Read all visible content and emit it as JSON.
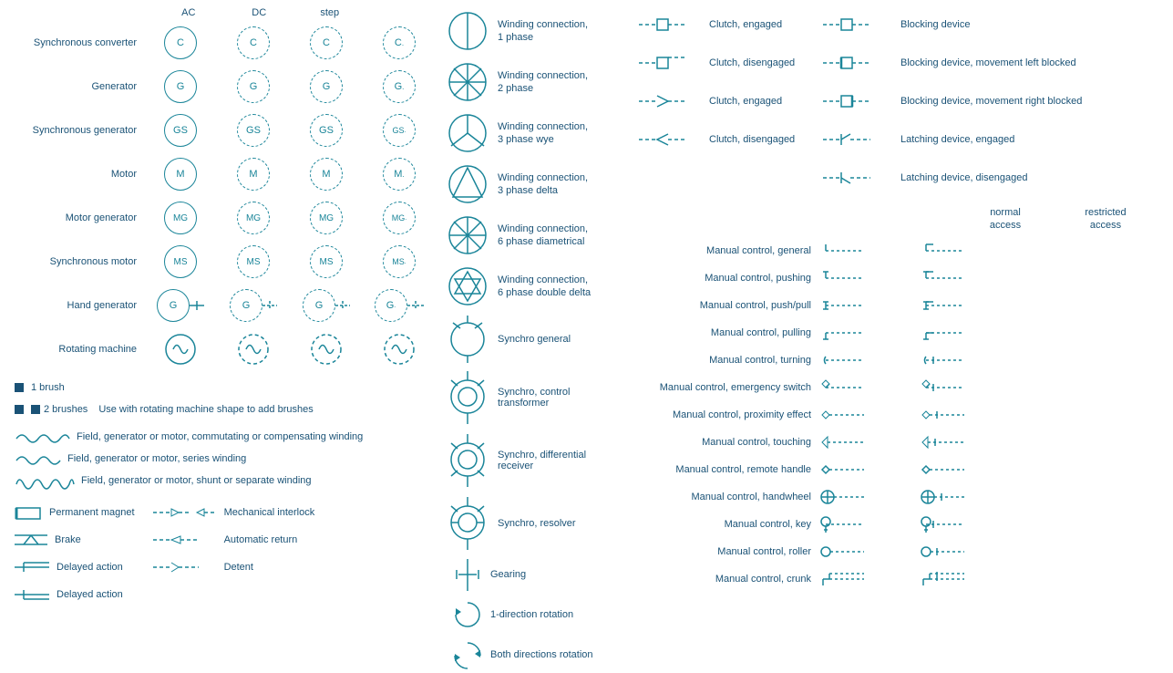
{
  "columns": {
    "labels": [
      "AC",
      "DC",
      "step"
    ]
  },
  "machines": [
    {
      "label": "Synchronous converter",
      "symbol": "C"
    },
    {
      "label": "Generator",
      "symbol": "G"
    },
    {
      "label": "Synchronous generator",
      "symbol": "GS"
    },
    {
      "label": "Motor",
      "symbol": "M"
    },
    {
      "label": "Motor generator",
      "symbol": "MG"
    },
    {
      "label": "Synchronous motor",
      "symbol": "MS"
    },
    {
      "label": "Hand generator",
      "symbol": "G",
      "has_lines": true
    },
    {
      "label": "Rotating machine",
      "symbol": "",
      "is_arc": true
    }
  ],
  "brushes": [
    {
      "label": "1 brush"
    },
    {
      "label": "2 brushes",
      "extra": "Use with rotating machine shape to add brushes"
    }
  ],
  "windings": [
    {
      "label": "Field, generator or motor, commutating or compensating winding"
    },
    {
      "label": "Field, generator or motor, series winding"
    },
    {
      "label": "Field, generator or motor, shunt or separate winding"
    }
  ],
  "misc_left": [
    {
      "symbol": "bracket",
      "label": "Permanent magnet"
    },
    {
      "symbol": "brake",
      "label": "Brake"
    },
    {
      "symbol": "delayed",
      "label": "Delayed action"
    },
    {
      "symbol": "delayed2",
      "label": "Delayed action"
    }
  ],
  "misc_right": [
    {
      "symbol": "mech_interlock",
      "label": "Mechanical interlock"
    },
    {
      "symbol": "auto_return",
      "label": "Automatic return"
    },
    {
      "symbol": "detent",
      "label": "Detent"
    }
  ],
  "winding_connections": [
    {
      "label": "Winding connection, 1 phase"
    },
    {
      "label": "Winding connection, 2 phase"
    },
    {
      "label": "Winding connection, 3 phase wye"
    },
    {
      "label": "Winding connection, 3 phase delta"
    },
    {
      "label": "Winding connection, 6 phase diametrical"
    },
    {
      "label": "Winding connection, 6 phase double delta"
    }
  ],
  "synchros": [
    {
      "label": "Synchro general"
    },
    {
      "label": "Synchro, control transformer"
    },
    {
      "label": "Synchro, differential receiver"
    },
    {
      "label": "Synchro, resolver"
    }
  ],
  "gearing": [
    {
      "label": "Gearing"
    },
    {
      "label": "1-direction rotation"
    },
    {
      "label": "Both directions rotation"
    }
  ],
  "clutches": [
    {
      "label": "Clutch, engaged"
    },
    {
      "label": "Clutch, disengaged"
    },
    {
      "label": "Clutch, engaged"
    },
    {
      "label": "Clutch, disengaged"
    }
  ],
  "blocking": [
    {
      "label": "Blocking device"
    },
    {
      "label": "Blocking device, movement left blocked"
    },
    {
      "label": "Blocking device, movement right blocked"
    },
    {
      "label": "Latching device, engaged"
    },
    {
      "label": "Latching device, disengaged"
    }
  ],
  "access_headers": [
    "normal access",
    "restricted access"
  ],
  "manual_controls": [
    {
      "label": "Manual control, general"
    },
    {
      "label": "Manual control, pushing"
    },
    {
      "label": "Manual control, push/pull"
    },
    {
      "label": "Manual control, pulling"
    },
    {
      "label": "Manual control, turning"
    },
    {
      "label": "Manual control, emergency switch"
    },
    {
      "label": "Manual control, proximity effect"
    },
    {
      "label": "Manual control, touching"
    },
    {
      "label": "Manual control, remote handle"
    },
    {
      "label": "Manual control, handwheel"
    },
    {
      "label": "Manual control, key"
    },
    {
      "label": "Manual control, roller"
    },
    {
      "label": "Manual control, crunk"
    }
  ]
}
